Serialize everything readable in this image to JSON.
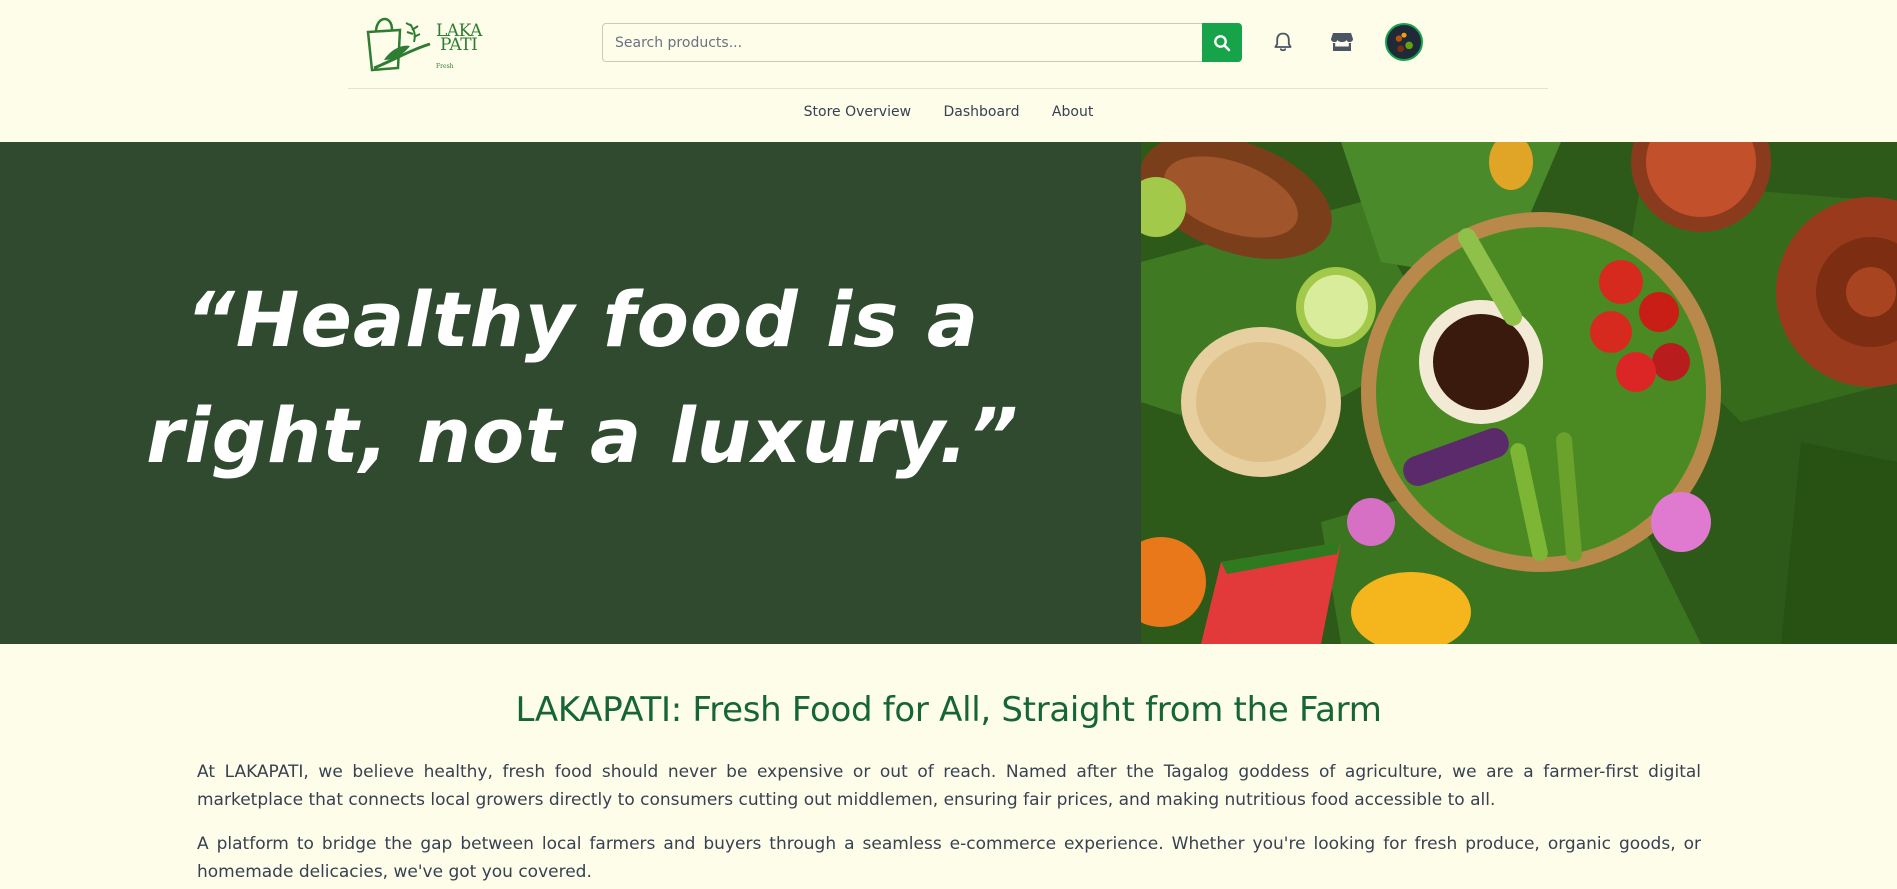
{
  "brand": {
    "logo_line1": "LAKA",
    "logo_line2": "PATI",
    "logo_line3": "Fresh"
  },
  "search": {
    "placeholder": "Search products...",
    "value": ""
  },
  "header_icons": [
    "search-icon",
    "bell-icon",
    "store-icon",
    "avatar"
  ],
  "nav": {
    "items": [
      {
        "label": "Store Overview"
      },
      {
        "label": "Dashboard"
      },
      {
        "label": "About"
      }
    ]
  },
  "hero": {
    "quote_line1": "“Healthy food is a",
    "quote_line2": "right, not a luxury.”"
  },
  "about": {
    "title": "LAKAPATI: Fresh Food for All, Straight from the Farm",
    "paragraph1": "At LAKAPATI, we believe healthy, fresh food should never be expensive or out of reach. Named after the Tagalog goddess of agriculture, we are a farmer-first digital marketplace that connects local growers directly to consumers cutting out middlemen, ensuring fair prices, and making nutritious food accessible to all.",
    "paragraph2": "A platform to bridge the gap between local farmers and buyers through a seamless e-commerce experience. Whether you're looking for fresh produce, organic goods, or homemade delicacies, we've got you covered."
  },
  "colors": {
    "background": "#fdfdea",
    "brand_green": "#16a34a",
    "hero_panel": "#2f4a2f",
    "title_green": "#166534"
  }
}
